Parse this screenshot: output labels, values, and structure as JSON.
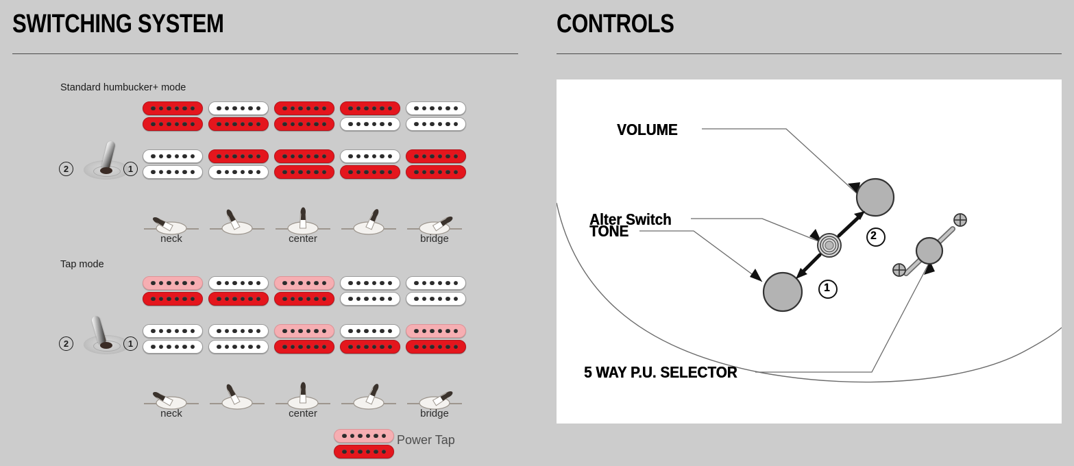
{
  "left": {
    "heading": "SWITCHING SYSTEM",
    "modes": [
      {
        "label": "Standard humbucker+ mode",
        "switch_position": "1",
        "switch_left_number": "2",
        "switch_right_number": "1",
        "rows": [
          {
            "row": "neck_pickup",
            "coils": [
              [
                "red",
                "red"
              ],
              [
                "white",
                "red"
              ],
              [
                "red",
                "red"
              ],
              [
                "red",
                "white"
              ],
              [
                "white",
                "white"
              ]
            ]
          },
          {
            "row": "bridge_pickup",
            "coils": [
              [
                "white",
                "white"
              ],
              [
                "red",
                "white"
              ],
              [
                "red",
                "red"
              ],
              [
                "white",
                "red"
              ],
              [
                "red",
                "red"
              ]
            ]
          }
        ],
        "selector_positions": [
          "neck",
          "",
          "center",
          "",
          "bridge"
        ]
      },
      {
        "label": "Tap mode",
        "switch_position": "2",
        "switch_left_number": "2",
        "switch_right_number": "1",
        "rows": [
          {
            "row": "neck_pickup",
            "coils": [
              [
                "pink",
                "red"
              ],
              [
                "white",
                "red"
              ],
              [
                "pink",
                "red"
              ],
              [
                "white",
                "white"
              ],
              [
                "white",
                "white"
              ]
            ]
          },
          {
            "row": "bridge_pickup",
            "coils": [
              [
                "white",
                "white"
              ],
              [
                "white",
                "white"
              ],
              [
                "pink",
                "red"
              ],
              [
                "white",
                "red"
              ],
              [
                "pink",
                "red"
              ]
            ]
          }
        ],
        "selector_positions": [
          "neck",
          "",
          "center",
          "",
          "bridge"
        ]
      }
    ],
    "legend": {
      "power_tap_label": "Power Tap",
      "power_tap_coils": [
        "pink",
        "red"
      ]
    },
    "poles_per_coil": 6
  },
  "right": {
    "heading": "CONTROLS",
    "labels": {
      "volume": "VOLUME",
      "alter_switch": "Alter Switch",
      "tone": "TONE",
      "selector": "5 WAY P.U. SELECTOR"
    },
    "alter_switch_positions": {
      "up": "2",
      "down": "1"
    }
  },
  "colors": {
    "background": "#cccccc",
    "panel": "#ffffff",
    "coil_red": "#e4161d",
    "coil_pink": "#f6aeb2",
    "coil_white": "#ffffff",
    "pole": "#2b2b2b",
    "text": "#000000",
    "rule": "#4a4a4a",
    "knob_fill": "#b3b3b3",
    "knob_stroke": "#333333"
  }
}
